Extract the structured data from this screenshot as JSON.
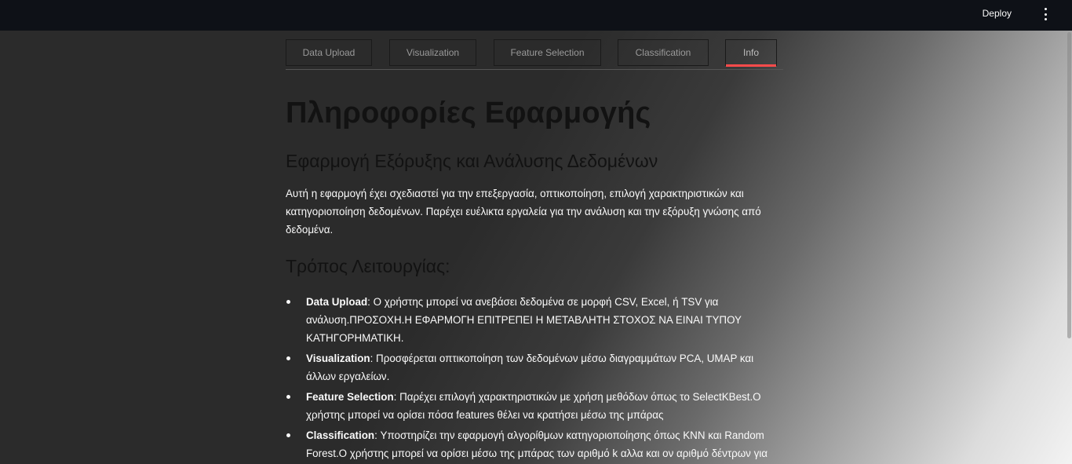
{
  "header": {
    "deploy_label": "Deploy",
    "menu_icon": "kebab-menu-icon"
  },
  "tabs": [
    {
      "label": "Data Upload",
      "active": false
    },
    {
      "label": "Visualization",
      "active": false
    },
    {
      "label": "Feature Selection",
      "active": false
    },
    {
      "label": "Classification",
      "active": false
    },
    {
      "label": "Info",
      "active": true
    }
  ],
  "colors": {
    "accent": "#ff4b4b",
    "topbar": "#0e1117",
    "background": "#2b2b2b"
  },
  "content": {
    "title": "Πληροφορίες Εφαρμογής",
    "subtitle": "Εφαρμογή Εξόρυξης και Ανάλυσης Δεδομένων",
    "intro": "Αυτή η εφαρμογή έχει σχεδιαστεί για την επεξεργασία, οπτικοποίηση, επιλογή χαρακτηριστικών και κατηγοριοποίηση δεδομένων. Παρέχει ευέλικτα εργαλεία για την ανάλυση και την εξόρυξη γνώσης από δεδομένα.",
    "how_title": "Τρόπος Λειτουργίας:",
    "items": [
      {
        "name": "Data Upload",
        "text": ": Ο χρήστης μπορεί να ανεβάσει δεδομένα σε μορφή CSV, Excel, ή TSV για ανάλυση.ΠΡΟΣΟΧΗ.Η ΕΦΑΡΜΟΓΗ ΕΠΙΤΡΕΠΕΙ Η ΜΕΤΑΒΛΗΤΗ ΣΤΟΧΟΣ ΝΑ ΕΙΝΑΙ ΤΥΠΟΥ ΚΑΤΗΓΟΡΗΜΑΤΙΚΗ."
      },
      {
        "name": "Visualization",
        "text": ": Προσφέρεται οπτικοποίηση των δεδομένων μέσω διαγραμμάτων PCA, UMAP και άλλων εργαλείων."
      },
      {
        "name": "Feature Selection",
        "text": ": Παρέχει επιλογή χαρακτηριστικών με χρήση μεθόδων όπως το SelectKBest.Ο χρήστης μπορεί να ορίσει πόσα features θέλει να κρατήσει μέσω της μπάρας"
      },
      {
        "name": "Classification",
        "text": ": Υποστηρίζει την εφαρμογή αλγορίθμων κατηγοριοποίησης όπως KNN και Random Forest.Ο χρήστης μπορεί να ορίσει μέσω της μπάρας των αριθμό k αλλα και ον αριθμό δέντρων για"
      }
    ]
  }
}
